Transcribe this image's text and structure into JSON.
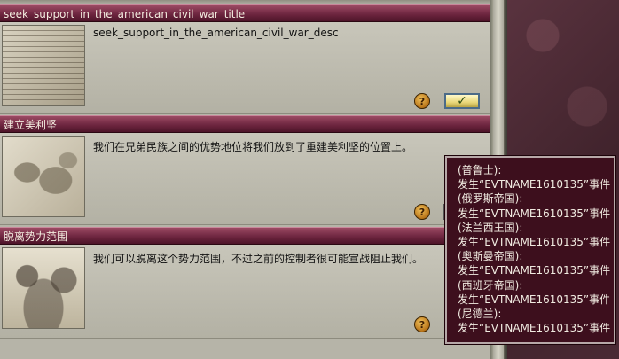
{
  "events": [
    {
      "title": "seek_support_in_the_american_civil_war_title",
      "description": "seek_support_in_the_american_civil_war_desc",
      "image_icon": "document-manuscript-image",
      "help_label": "?",
      "ok_label": "✓"
    },
    {
      "title": "建立美利坚",
      "description": "我们在兄弟民族之间的优势地位将我们放到了重建美利坚的位置上。",
      "image_icon": "world-map-image",
      "help_label": "?"
    },
    {
      "title": "脱离势力范围",
      "description": "我们可以脱离这个势力范围，不过之前的控制者很可能宣战阻止我们。",
      "image_icon": "lion-cartoon-image",
      "help_label": "?"
    }
  ],
  "tooltip": {
    "lines": [
      "(普鲁士):",
      "发生“EVTNAME1610135”事件",
      "(俄罗斯帝国):",
      "发生“EVTNAME1610135”事件",
      "(法兰西王国):",
      "发生“EVTNAME1610135”事件",
      "(奥斯曼帝国):",
      "发生“EVTNAME1610135”事件",
      "(西班牙帝国):",
      "发生“EVTNAME1610135”事件",
      "(尼德兰):",
      "发生“EVTNAME1610135”事件"
    ]
  },
  "colors": {
    "title_bar": "#6e2640",
    "panel_bg": "#b6b4a8",
    "tooltip_bg": "#3d0f1d"
  }
}
